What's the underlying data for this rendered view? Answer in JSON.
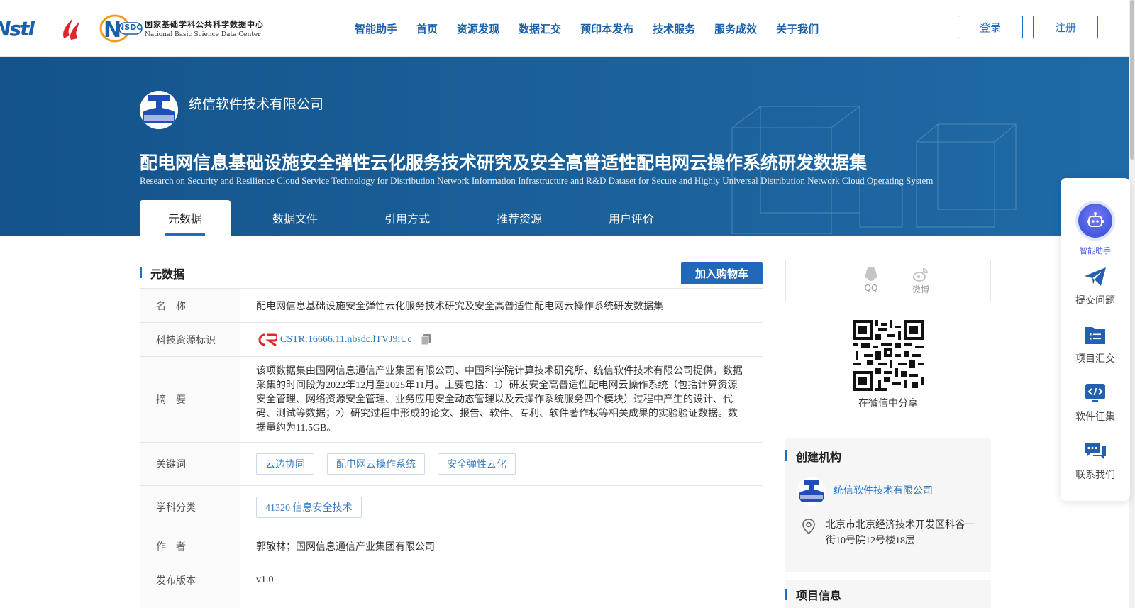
{
  "header": {
    "logo_nstl": "Nstl",
    "nsdc_mark": "NSDC",
    "nsdc_cn": "国家基础学科公共科学数据中心",
    "nsdc_en": "National Basic Science Data Center",
    "nav": [
      "智能助手",
      "首页",
      "资源发现",
      "数据汇交",
      "预印本发布",
      "技术服务",
      "服务成效",
      "关于我们"
    ],
    "login": "登录",
    "register": "注册"
  },
  "banner": {
    "org_name": "统信软件技术有限公司",
    "title": "配电网信息基础设施安全弹性云化服务技术研究及安全高普适性配电网云操作系统研发数据集",
    "title_en": "Research on Security and Resilience Cloud Service Technology for Distribution Network Information Infrastructure and R&D Dataset for Secure and Highly Universal Distribution Network Cloud Operating System",
    "tabs": [
      "元数据",
      "数据文件",
      "引用方式",
      "推荐资源",
      "用户评价"
    ]
  },
  "metadata": {
    "section_title": "元数据",
    "cart_button": "加入购物车",
    "rows": {
      "name_key": "名　称",
      "name_val": "配电网信息基础设施安全弹性云化服务技术研究及安全高普适性配电网云操作系统研发数据集",
      "id_key": "科技资源标识",
      "id_val": "CSTR:16666.11.nbsdc.lTVJ9iUc",
      "abstract_key": "摘　要",
      "abstract_val": "该项数据集由国网信息通信产业集团有限公司、中国科学院计算技术研究所、统信软件技术有限公司提供，数据采集的时间段为2022年12月至2025年11月。主要包括：1）研发安全高普适性配电网云操作系统（包括计算资源安全管理、网络资源安全管理、业务应用安全动态管理以及云操作系统服务四个模块）过程中产生的设计、代码、测试等数据；2）研究过程中形成的论文、报告、软件、专利、软件著作权等相关成果的实验验证数据。数据量约为11.5GB。",
      "keywords_key": "关键词",
      "keywords": [
        "云边协同",
        "配电网云操作系统",
        "安全弹性云化"
      ],
      "subject_key": "学科分类",
      "subjects": [
        "41320 信息安全技术"
      ],
      "author_key": "作　者",
      "author_val": "郭敬林；国网信息通信产业集团有限公司",
      "version_key": "发布版本",
      "version_val": "v1.0"
    }
  },
  "sidebar": {
    "share_qq": "QQ",
    "share_weibo": "微博",
    "qr_caption": "在微信中分享",
    "org_card_title": "创建机构",
    "org_card_name": "统信软件技术有限公司",
    "org_card_address": "北京市北京经济技术开发区科谷一街10号院12号楼18层",
    "project_card_title": "项目信息"
  },
  "float_panel": {
    "ai": "智能助手",
    "submit": "提交问题",
    "project": "项目汇交",
    "software": "软件征集",
    "contact": "联系我们"
  },
  "colors": {
    "brand_blue": "#1a5fa8",
    "banner_blue": "#17598f",
    "link_blue": "#2a78c0",
    "button_blue": "#2168b8"
  }
}
